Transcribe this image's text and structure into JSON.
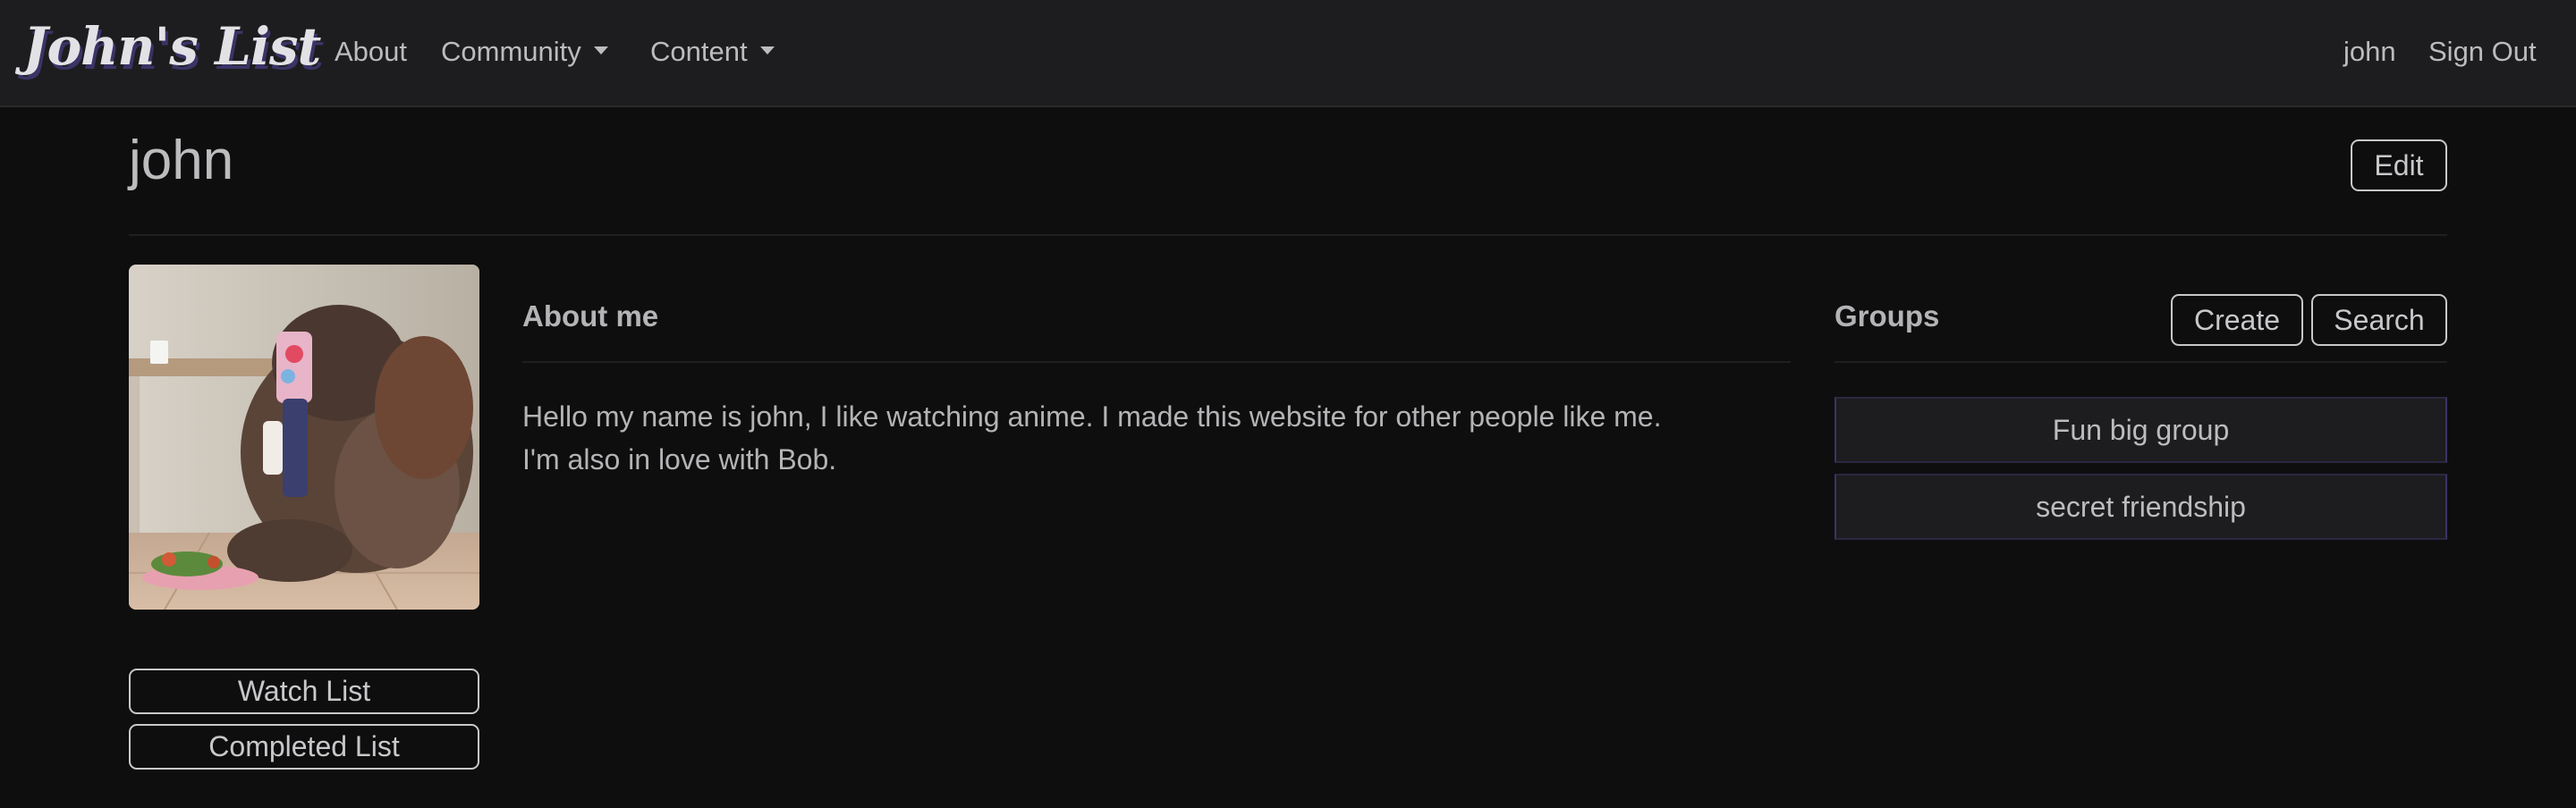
{
  "navbar": {
    "brand": "John's List",
    "links": {
      "about": "About",
      "community": "Community",
      "content": "Content"
    },
    "username": "john",
    "sign_out": "Sign Out"
  },
  "profile": {
    "name": "john",
    "edit_label": "Edit",
    "about_title": "About me",
    "bio_lines": [
      "Hello my name is john, I like watching anime. I made this website for other people like me.",
      "I'm also in love with Bob."
    ],
    "watch_list_label": "Watch List",
    "completed_list_label": "Completed List"
  },
  "groups": {
    "title": "Groups",
    "create_label": "Create",
    "search_label": "Search",
    "items": [
      {
        "name": "Fun big group"
      },
      {
        "name": "secret friendship"
      }
    ]
  },
  "colors": {
    "background": "#0e0e0f",
    "navbar": "#1d1d1f",
    "text": "#b4b4b6",
    "brand_shadow": "#3a3466"
  }
}
